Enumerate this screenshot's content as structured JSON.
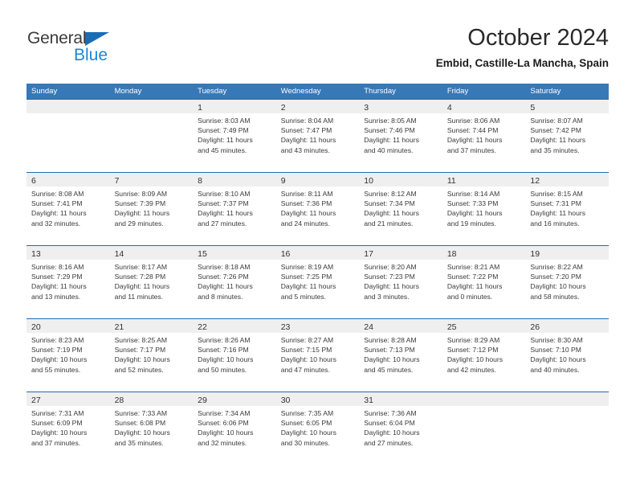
{
  "brand": {
    "name_part1": "General",
    "name_part2": "Blue",
    "triangle_color": "#1a6db5",
    "blue_color": "#1a87d8",
    "gray_color": "#3b3b3b"
  },
  "header": {
    "title": "October 2024",
    "subtitle": "Embid, Castille-La Mancha, Spain"
  },
  "theme": {
    "header_bar_color": "#3778b8",
    "row_divider_color": "#1f6cb0",
    "day_band_color": "#efefef"
  },
  "weekdays": [
    "Sunday",
    "Monday",
    "Tuesday",
    "Wednesday",
    "Thursday",
    "Friday",
    "Saturday"
  ],
  "weeks": [
    [
      {
        "day": "",
        "lines": []
      },
      {
        "day": "",
        "lines": []
      },
      {
        "day": "1",
        "lines": [
          "Sunrise: 8:03 AM",
          "Sunset: 7:49 PM",
          "Daylight: 11 hours",
          "and 45 minutes."
        ]
      },
      {
        "day": "2",
        "lines": [
          "Sunrise: 8:04 AM",
          "Sunset: 7:47 PM",
          "Daylight: 11 hours",
          "and 43 minutes."
        ]
      },
      {
        "day": "3",
        "lines": [
          "Sunrise: 8:05 AM",
          "Sunset: 7:46 PM",
          "Daylight: 11 hours",
          "and 40 minutes."
        ]
      },
      {
        "day": "4",
        "lines": [
          "Sunrise: 8:06 AM",
          "Sunset: 7:44 PM",
          "Daylight: 11 hours",
          "and 37 minutes."
        ]
      },
      {
        "day": "5",
        "lines": [
          "Sunrise: 8:07 AM",
          "Sunset: 7:42 PM",
          "Daylight: 11 hours",
          "and 35 minutes."
        ]
      }
    ],
    [
      {
        "day": "6",
        "lines": [
          "Sunrise: 8:08 AM",
          "Sunset: 7:41 PM",
          "Daylight: 11 hours",
          "and 32 minutes."
        ]
      },
      {
        "day": "7",
        "lines": [
          "Sunrise: 8:09 AM",
          "Sunset: 7:39 PM",
          "Daylight: 11 hours",
          "and 29 minutes."
        ]
      },
      {
        "day": "8",
        "lines": [
          "Sunrise: 8:10 AM",
          "Sunset: 7:37 PM",
          "Daylight: 11 hours",
          "and 27 minutes."
        ]
      },
      {
        "day": "9",
        "lines": [
          "Sunrise: 8:11 AM",
          "Sunset: 7:36 PM",
          "Daylight: 11 hours",
          "and 24 minutes."
        ]
      },
      {
        "day": "10",
        "lines": [
          "Sunrise: 8:12 AM",
          "Sunset: 7:34 PM",
          "Daylight: 11 hours",
          "and 21 minutes."
        ]
      },
      {
        "day": "11",
        "lines": [
          "Sunrise: 8:14 AM",
          "Sunset: 7:33 PM",
          "Daylight: 11 hours",
          "and 19 minutes."
        ]
      },
      {
        "day": "12",
        "lines": [
          "Sunrise: 8:15 AM",
          "Sunset: 7:31 PM",
          "Daylight: 11 hours",
          "and 16 minutes."
        ]
      }
    ],
    [
      {
        "day": "13",
        "lines": [
          "Sunrise: 8:16 AM",
          "Sunset: 7:29 PM",
          "Daylight: 11 hours",
          "and 13 minutes."
        ]
      },
      {
        "day": "14",
        "lines": [
          "Sunrise: 8:17 AM",
          "Sunset: 7:28 PM",
          "Daylight: 11 hours",
          "and 11 minutes."
        ]
      },
      {
        "day": "15",
        "lines": [
          "Sunrise: 8:18 AM",
          "Sunset: 7:26 PM",
          "Daylight: 11 hours",
          "and 8 minutes."
        ]
      },
      {
        "day": "16",
        "lines": [
          "Sunrise: 8:19 AM",
          "Sunset: 7:25 PM",
          "Daylight: 11 hours",
          "and 5 minutes."
        ]
      },
      {
        "day": "17",
        "lines": [
          "Sunrise: 8:20 AM",
          "Sunset: 7:23 PM",
          "Daylight: 11 hours",
          "and 3 minutes."
        ]
      },
      {
        "day": "18",
        "lines": [
          "Sunrise: 8:21 AM",
          "Sunset: 7:22 PM",
          "Daylight: 11 hours",
          "and 0 minutes."
        ]
      },
      {
        "day": "19",
        "lines": [
          "Sunrise: 8:22 AM",
          "Sunset: 7:20 PM",
          "Daylight: 10 hours",
          "and 58 minutes."
        ]
      }
    ],
    [
      {
        "day": "20",
        "lines": [
          "Sunrise: 8:23 AM",
          "Sunset: 7:19 PM",
          "Daylight: 10 hours",
          "and 55 minutes."
        ]
      },
      {
        "day": "21",
        "lines": [
          "Sunrise: 8:25 AM",
          "Sunset: 7:17 PM",
          "Daylight: 10 hours",
          "and 52 minutes."
        ]
      },
      {
        "day": "22",
        "lines": [
          "Sunrise: 8:26 AM",
          "Sunset: 7:16 PM",
          "Daylight: 10 hours",
          "and 50 minutes."
        ]
      },
      {
        "day": "23",
        "lines": [
          "Sunrise: 8:27 AM",
          "Sunset: 7:15 PM",
          "Daylight: 10 hours",
          "and 47 minutes."
        ]
      },
      {
        "day": "24",
        "lines": [
          "Sunrise: 8:28 AM",
          "Sunset: 7:13 PM",
          "Daylight: 10 hours",
          "and 45 minutes."
        ]
      },
      {
        "day": "25",
        "lines": [
          "Sunrise: 8:29 AM",
          "Sunset: 7:12 PM",
          "Daylight: 10 hours",
          "and 42 minutes."
        ]
      },
      {
        "day": "26",
        "lines": [
          "Sunrise: 8:30 AM",
          "Sunset: 7:10 PM",
          "Daylight: 10 hours",
          "and 40 minutes."
        ]
      }
    ],
    [
      {
        "day": "27",
        "lines": [
          "Sunrise: 7:31 AM",
          "Sunset: 6:09 PM",
          "Daylight: 10 hours",
          "and 37 minutes."
        ]
      },
      {
        "day": "28",
        "lines": [
          "Sunrise: 7:33 AM",
          "Sunset: 6:08 PM",
          "Daylight: 10 hours",
          "and 35 minutes."
        ]
      },
      {
        "day": "29",
        "lines": [
          "Sunrise: 7:34 AM",
          "Sunset: 6:06 PM",
          "Daylight: 10 hours",
          "and 32 minutes."
        ]
      },
      {
        "day": "30",
        "lines": [
          "Sunrise: 7:35 AM",
          "Sunset: 6:05 PM",
          "Daylight: 10 hours",
          "and 30 minutes."
        ]
      },
      {
        "day": "31",
        "lines": [
          "Sunrise: 7:36 AM",
          "Sunset: 6:04 PM",
          "Daylight: 10 hours",
          "and 27 minutes."
        ]
      },
      {
        "day": "",
        "lines": []
      },
      {
        "day": "",
        "lines": []
      }
    ]
  ]
}
